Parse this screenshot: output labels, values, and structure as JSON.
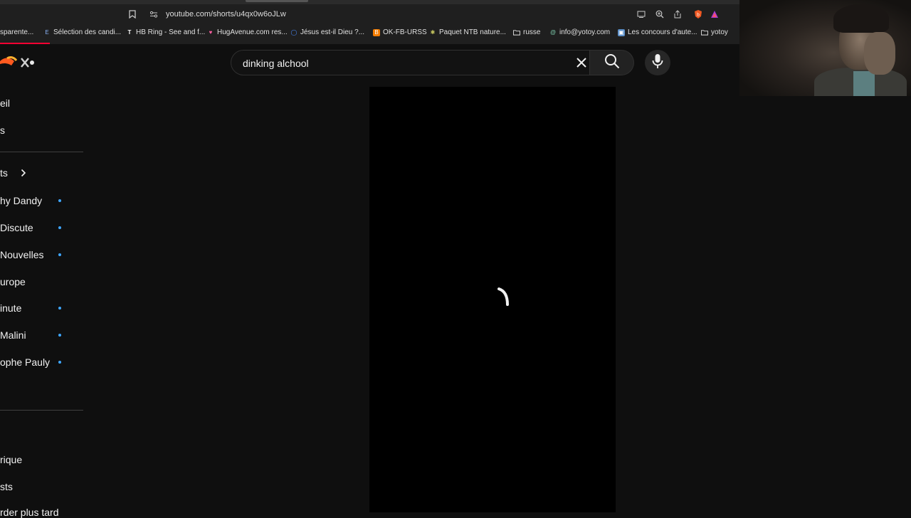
{
  "browser": {
    "url": "youtube.com/shorts/u4qx0w6oJLw",
    "bookmarks": [
      {
        "label": "sparente...",
        "icon": "none"
      },
      {
        "label": "Sélection des candi...",
        "icon": "page-icon"
      },
      {
        "label": "HB Ring - See and f...",
        "icon": "t-icon"
      },
      {
        "label": "HugAvenue.com res...",
        "icon": "heart-icon"
      },
      {
        "label": "Jésus est-il Dieu ?...",
        "icon": "circle-icon"
      },
      {
        "label": "OK-FB-URSS",
        "icon": "blogger-icon"
      },
      {
        "label": "Paquet NTB nature...",
        "icon": "plant-icon"
      },
      {
        "label": "russe",
        "icon": "folder-icon"
      },
      {
        "label": "info@yotoy.com",
        "icon": "contact-icon"
      },
      {
        "label": "Les concours d'aute...",
        "icon": "image-icon"
      },
      {
        "label": "yotoy",
        "icon": "folder-icon"
      }
    ]
  },
  "search": {
    "value": "dinking alchool"
  },
  "sidebar": {
    "top_items": [
      "eil",
      "s"
    ],
    "subscriptions_header": "ts",
    "subscriptions": [
      {
        "label": "hy Dandy",
        "new": true
      },
      {
        "label": " Discute",
        "new": true
      },
      {
        "label": "Nouvelles",
        "new": true
      },
      {
        "label": "urope",
        "new": false
      },
      {
        "label": "inute",
        "new": true
      },
      {
        "label": " Malini",
        "new": true
      },
      {
        "label": "ophe Pauly",
        "new": true
      }
    ],
    "bottom_items": [
      "rique",
      "sts",
      "rder plus tard"
    ]
  },
  "colors": {
    "background": "#0f0f0f",
    "accent_blue": "#3ea6ff",
    "progress_red": "#ff0033"
  }
}
